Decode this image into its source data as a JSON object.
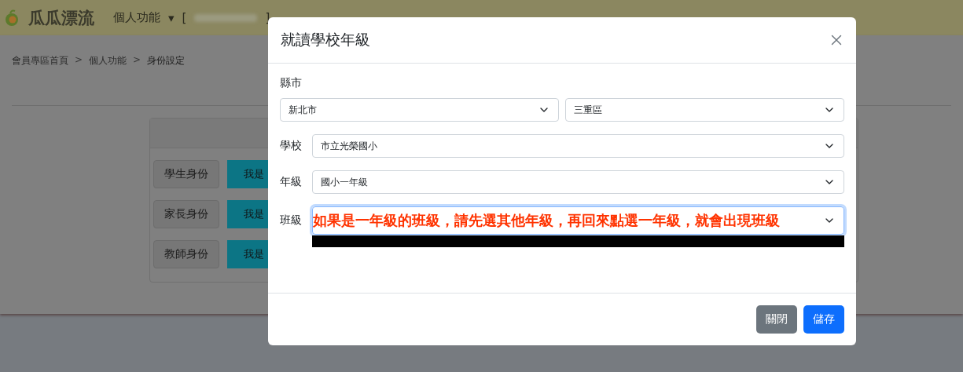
{
  "header": {
    "logo": "瓜瓜漂流",
    "menu": "個人功能",
    "caret": "▾",
    "user_open": "[",
    "user_close": "]"
  },
  "breadcrumb": [
    {
      "kind": "link",
      "text": "會員專區首頁"
    },
    {
      "kind": "sep",
      "text": ">"
    },
    {
      "kind": "link",
      "text": "個人功能"
    },
    {
      "kind": "sep",
      "text": ">"
    },
    {
      "kind": "current",
      "text": "身份設定"
    }
  ],
  "identities": [
    {
      "label": "學生身份",
      "button": "我是"
    },
    {
      "label": "家長身份",
      "button": "我是"
    },
    {
      "label": "教師身份",
      "button": "我是"
    }
  ],
  "modal": {
    "title": "就讀學校年級",
    "region_label": "縣市",
    "region_selects": [
      "新北市",
      "三重區"
    ],
    "rows": [
      {
        "label": "學校",
        "value": "市立光榮國小",
        "focused": false
      },
      {
        "label": "年級",
        "value": "國小一年級",
        "focused": false
      },
      {
        "label": "班級",
        "note": "如果是一年級的班級，請先選其他年級，再回來點選一年級，就會出現班級",
        "focused": true
      }
    ],
    "buttons": [
      {
        "label": "關閉",
        "kind": "secondary"
      },
      {
        "label": "儲存",
        "kind": "primary"
      }
    ]
  }
}
